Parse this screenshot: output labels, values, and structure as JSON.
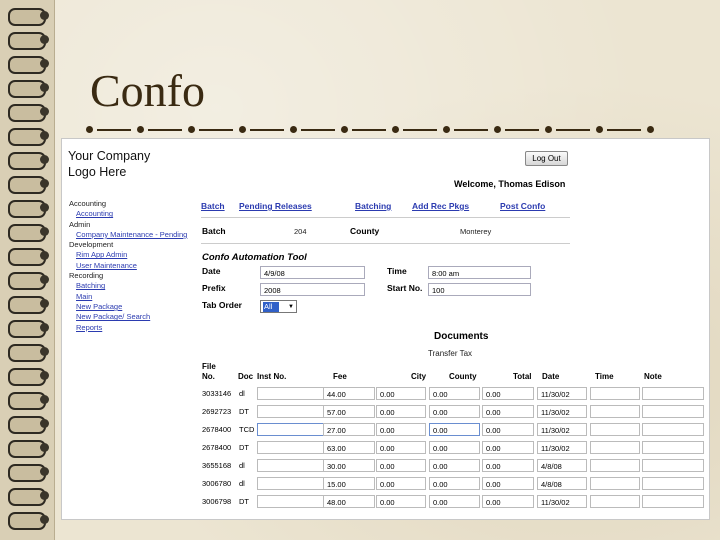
{
  "slide": {
    "title": "Confo"
  },
  "app": {
    "logo_line1": "Your Company",
    "logo_line2": "Logo Here",
    "logout_label": "Log Out",
    "welcome": "Welcome, Thomas Edison"
  },
  "sidebar": {
    "items": [
      {
        "label": "Accounting",
        "kind": "h"
      },
      {
        "label": "Accounting",
        "kind": "l"
      },
      {
        "label": "Admin",
        "kind": "h"
      },
      {
        "label": "Company Maintenance - Pending",
        "kind": "l"
      },
      {
        "label": "Development",
        "kind": "h"
      },
      {
        "label": "Rim App Admin",
        "kind": "l"
      },
      {
        "label": "User Maintenance",
        "kind": "l"
      },
      {
        "label": "Recording",
        "kind": "h"
      },
      {
        "label": "Batching",
        "kind": "l"
      },
      {
        "label": "Main",
        "kind": "l"
      },
      {
        "label": "New Package",
        "kind": "l"
      },
      {
        "label": "New Package/ Search",
        "kind": "l"
      },
      {
        "label": "Reports",
        "kind": "l"
      }
    ]
  },
  "topnav": [
    "Batch",
    "Pending Releases",
    "Batching",
    "Add Rec Pkgs",
    "Post Confo"
  ],
  "batch": {
    "label": "Batch",
    "value": "204",
    "county_label": "County",
    "county_value": "Monterey"
  },
  "tool": {
    "title": "Confo Automation Tool",
    "date_label": "Date",
    "date_value": "4/9/08",
    "time_label": "Time",
    "time_value": "8:00 am",
    "prefix_label": "Prefix",
    "prefix_value": "2008",
    "start_label": "Start No.",
    "start_value": "100",
    "taborder_label": "Tab Order",
    "taborder_value": "All"
  },
  "documents": {
    "title": "Documents",
    "subtitle": "Transfer Tax",
    "headers": {
      "file": "File",
      "no": "No.",
      "doc": "Doc",
      "inst": "Inst No.",
      "fee": "Fee",
      "city": "City",
      "county": "County",
      "total": "Total",
      "date": "Date",
      "time": "Time",
      "note": "Note"
    },
    "rows": [
      {
        "file": "3033146",
        "doc": "dl",
        "fee": "44.00",
        "city": "0.00",
        "county": "0.00",
        "total": "0.00",
        "date": "11/30/02"
      },
      {
        "file": "2692723",
        "doc": "DT",
        "fee": "57.00",
        "city": "0.00",
        "county": "0.00",
        "total": "0.00",
        "date": "11/30/02"
      },
      {
        "file": "2678400",
        "doc": "TCD",
        "fee": "27.00",
        "city": "0.00",
        "county": "0.00",
        "total": "0.00",
        "date": "11/30/02"
      },
      {
        "file": "2678400",
        "doc": "DT",
        "fee": "63.00",
        "city": "0.00",
        "county": "0.00",
        "total": "0.00",
        "date": "11/30/02"
      },
      {
        "file": "3655168",
        "doc": "dl",
        "fee": "30.00",
        "city": "0.00",
        "county": "0.00",
        "total": "0.00",
        "date": "4/8/08"
      },
      {
        "file": "3006780",
        "doc": "dl",
        "fee": "15.00",
        "city": "0.00",
        "county": "0.00",
        "total": "0.00",
        "date": "4/8/08"
      },
      {
        "file": "3006798",
        "doc": "DT",
        "fee": "48.00",
        "city": "0.00",
        "county": "0.00",
        "total": "0.00",
        "date": "11/30/02"
      }
    ]
  }
}
